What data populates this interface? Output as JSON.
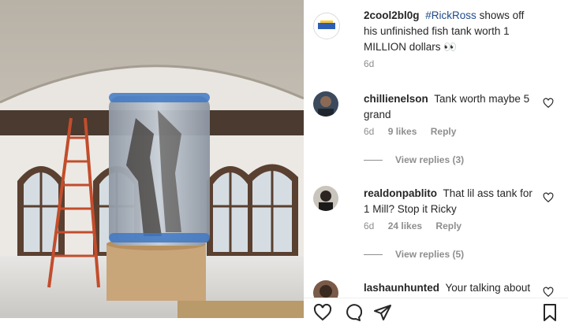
{
  "caption": {
    "username": "2cool2bl0g",
    "hashtag": "#RickRoss",
    "text": "shows off his unfinished fish tank worth 1 MILLION dollars",
    "emoji": "👀",
    "time": "6d"
  },
  "comments": [
    {
      "username": "chillienelson",
      "text": "Tank worth maybe 5 grand",
      "time": "6d",
      "likes": "9 likes",
      "reply": "Reply",
      "view_replies": "View replies (3)"
    },
    {
      "username": "realdonpablito",
      "text": "That lil ass tank for 1 Mill? Stop it Ricky",
      "time": "6d",
      "likes": "24 likes",
      "reply": "Reply",
      "view_replies": "View replies (5)"
    },
    {
      "username": "lashaunhunted",
      "text": "Your talking about"
    }
  ],
  "icons": [
    "heart-icon",
    "comment-icon",
    "share-icon",
    "save-icon"
  ],
  "colors": {
    "hashtag": "#1e4a8a",
    "muted": "#8e8e8e",
    "text": "#262626"
  }
}
